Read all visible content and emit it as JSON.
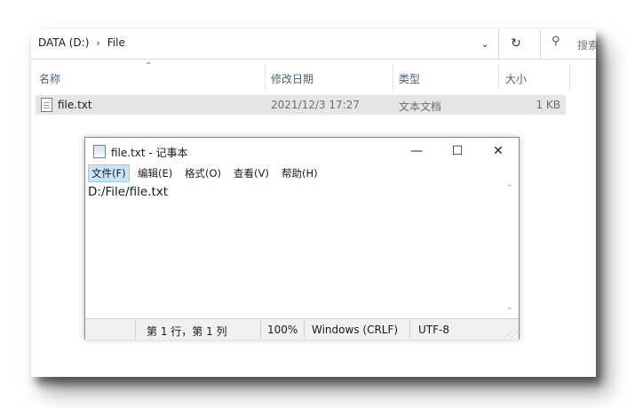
{
  "explorer": {
    "address": {
      "drive": "DATA (D:)",
      "folder": "File",
      "search_placeholder": "搜索"
    },
    "columns": [
      "名称",
      "修改日期",
      "类型",
      "大小"
    ],
    "files": [
      {
        "name": "file.txt",
        "modified": "2021/12/3 17:27",
        "type": "文本文档",
        "size": "1 KB"
      }
    ]
  },
  "notepad": {
    "title": "file.txt - 记事本",
    "window_buttons": {
      "minimize": "—",
      "maximize": "☐",
      "close": "✕"
    },
    "menu": [
      "文件(F)",
      "编辑(E)",
      "格式(O)",
      "查看(V)",
      "帮助(H)"
    ],
    "content": "D:/File/file.txt",
    "status": {
      "position": "第 1 行，第 1 列",
      "zoom": "100%",
      "line_ending": "Windows (CRLF)",
      "encoding": "UTF-8"
    }
  },
  "icons": [
    "chevron-right-icon",
    "chevron-down-icon",
    "refresh-icon",
    "search-icon",
    "text-file-icon",
    "notepad-icon",
    "sort-up-icon",
    "scroll-up-icon",
    "scroll-down-icon",
    "resize-grip-icon"
  ],
  "colors": {
    "selected_row": "#e5e5e5",
    "menu_active": "#cce4f7",
    "header_text": "#4c607a"
  }
}
